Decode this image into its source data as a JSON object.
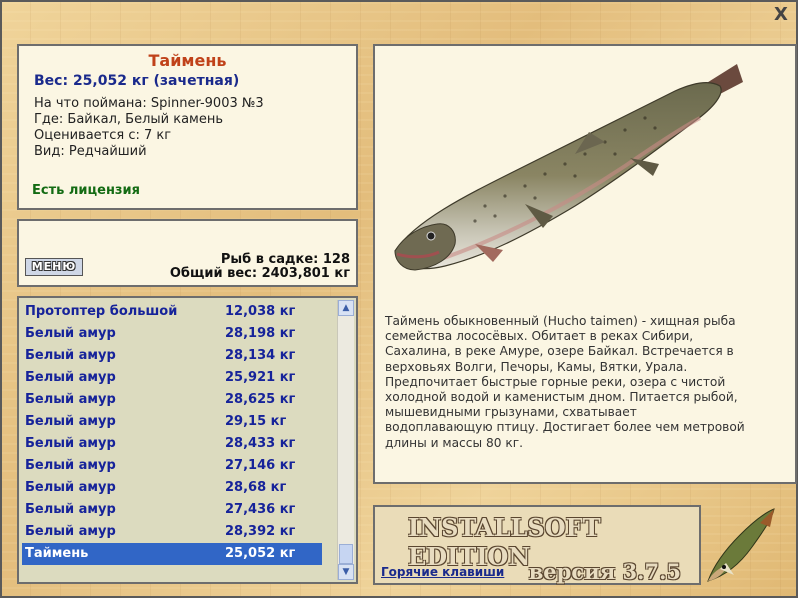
{
  "info": {
    "title": "Таймень",
    "weight": "Вес: 25,052 кг (зачетная)",
    "caught_on": "На что поймана: Spinner-9003 №3",
    "where": "Где: Байкал, Белый камень",
    "rated_from": "Оценивается с: 7 кг",
    "kind": "Вид: Редчайший",
    "license": "Есть лицензия"
  },
  "summary": {
    "menu_button": "МЕНЮ",
    "fish_count": "Рыб в садке: 128",
    "total_weight": "Общий вес: 2403,801 кг"
  },
  "catch_list": [
    {
      "name": "Протоптер большой",
      "weight": "12,038 кг"
    },
    {
      "name": "Белый амур",
      "weight": "28,198 кг"
    },
    {
      "name": "Белый амур",
      "weight": "28,134 кг"
    },
    {
      "name": "Белый амур",
      "weight": "25,921 кг"
    },
    {
      "name": "Белый амур",
      "weight": "28,625 кг"
    },
    {
      "name": "Белый амур",
      "weight": "29,15 кг"
    },
    {
      "name": "Белый амур",
      "weight": "28,433 кг"
    },
    {
      "name": "Белый амур",
      "weight": "27,146 кг"
    },
    {
      "name": "Белый амур",
      "weight": "28,68 кг"
    },
    {
      "name": "Белый амур",
      "weight": "27,436 кг"
    },
    {
      "name": "Белый амур",
      "weight": "28,392 кг"
    },
    {
      "name": "Таймень",
      "weight": "25,052 кг",
      "selected": true
    }
  ],
  "fish_panel": {
    "description": "Таймень обыкновенный (Hucho taimen) - хищная рыба семейства лососёвых. Обитает в реках Сибири, Сахалина, в реке Амуре, озере Байкал. Встречается в верховьях Волги, Печоры, Камы, Вятки, Урала. Предпочитает быстрые горные реки, озера с чистой холодной водой и каменистым дном. Питается рыбой, мышевидными грызунами, схватывает водоплавающую птицу. Достигает более чем метровой длины и массы 80 кг."
  },
  "version_panel": {
    "brand": "INSTALLSOFT EDITION",
    "hotkeys_link": "Горячие клавиши",
    "version": "версия 3.7.5"
  },
  "window": {
    "close_glyph": "X"
  },
  "colors": {
    "title": "#c0421a",
    "accent_blue": "#1a2a8c",
    "license_green": "#136b13",
    "selection": "#3166c6"
  }
}
